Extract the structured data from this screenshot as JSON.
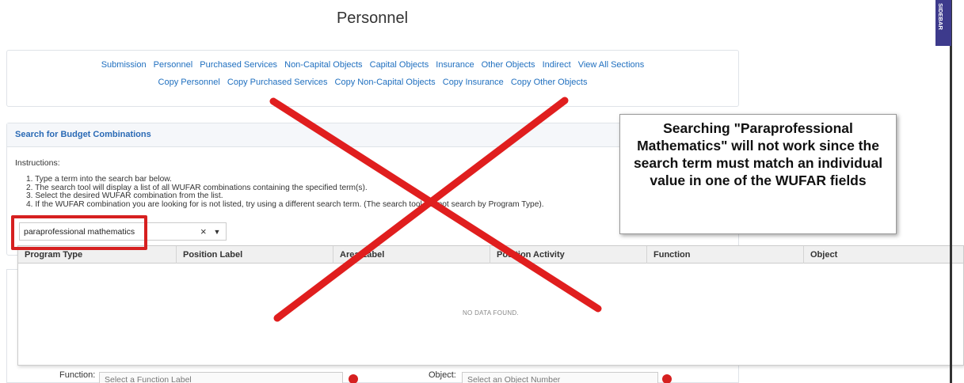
{
  "page": {
    "title": "Personnel"
  },
  "nav": {
    "row1": [
      "Submission",
      "Personnel",
      "Purchased Services",
      "Non-Capital Objects",
      "Capital Objects",
      "Insurance",
      "Other Objects",
      "Indirect",
      "View All Sections"
    ],
    "row2": [
      "Copy Personnel",
      "Copy Purchased Services",
      "Copy Non-Capital Objects",
      "Copy Insurance",
      "Copy Other Objects"
    ]
  },
  "search": {
    "header": "Search for Budget Combinations",
    "instructions_label": "Instructions:",
    "instructions": [
      "1. Type a term into the search bar below.",
      "2. The search tool will display a list of all WUFAR combinations containing the specified term(s).",
      "3. Select the desired WUFAR combination from the list.",
      "4. If the WUFAR combination you are looking for is not listed, try using a different search term. (The search tool will not search by Program Type)."
    ],
    "value": "paraprofessional mathematics",
    "clear_icon": "×",
    "dropdown_icon": "▼"
  },
  "results": {
    "columns": [
      "Program Type",
      "Position Label",
      "Area Label",
      "Position Activity",
      "Function",
      "Object"
    ],
    "empty_text": "NO DATA FOUND."
  },
  "lower": {
    "function_label": "Function:",
    "function_placeholder": "Select a Function Label",
    "object_label": "Object:",
    "object_placeholder": "Select an Object Number"
  },
  "callout": {
    "text": "Searching \"Paraprofessional Mathematics\" will not work since the search term must match an individual value in one of the WUFAR fields"
  },
  "sidebar": {
    "label": "SIDEBAR"
  },
  "colors": {
    "link": "#1f6fbf",
    "annotation_red": "#d62020",
    "sidebar_bg": "#3d3a8c"
  }
}
